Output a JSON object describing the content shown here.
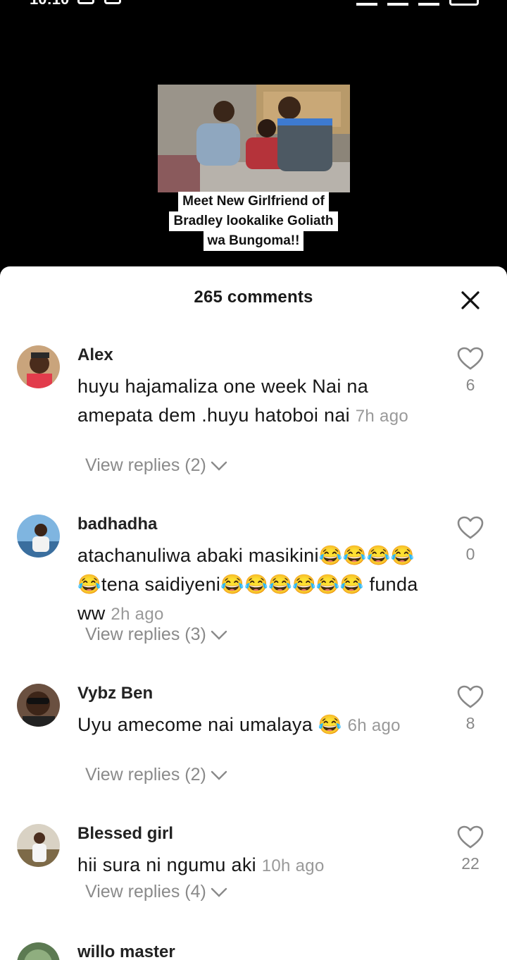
{
  "status": {
    "time": "10:10"
  },
  "video": {
    "caption_lines": [
      "Meet New Girlfriend of",
      "Bradley lookalike Goliath",
      "wa Bungoma!!"
    ]
  },
  "sheet": {
    "title": "265 comments"
  },
  "comments": [
    {
      "username": "Alex",
      "text": "huyu hajamaliza one week Nai na amepata dem .huyu hatoboi nai",
      "time": "7h ago",
      "likes": "6",
      "replies": "View replies (2)"
    },
    {
      "username": "badhadha",
      "text": "atachanuliwa abaki masikini😂😂😂😂😂tena saidiyeni😂😂😂😂😂😂 funda ww",
      "time": "2h ago",
      "likes": "0",
      "replies": "View replies (3)"
    },
    {
      "username": "Vybz Ben",
      "text": "Uyu amecome nai umalaya 😂",
      "time": "6h ago",
      "likes": "8",
      "replies": "View replies (2)"
    },
    {
      "username": "Blessed girl",
      "text": "hii sura ni ngumu aki",
      "time": "10h ago",
      "likes": "22",
      "replies": "View replies (4)"
    },
    {
      "username": "willo master"
    }
  ]
}
